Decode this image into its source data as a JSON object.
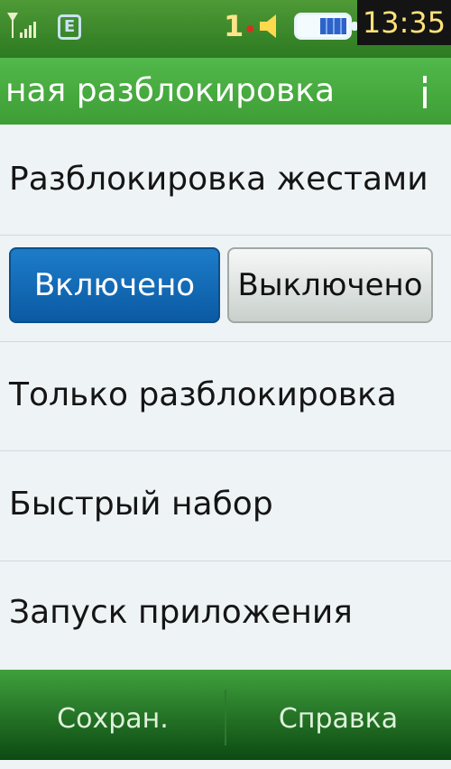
{
  "status_bar": {
    "network_type": "E",
    "sim_indicator": "1",
    "time": "13:35",
    "icons": [
      "signal-icon",
      "network-icon",
      "sim-icon",
      "volume-icon",
      "battery-icon"
    ]
  },
  "header": {
    "title": "ная разблокировка",
    "accent_color": "#3d9e35"
  },
  "settings": {
    "gesture_unlock_label": "Разблокировка жестами",
    "toggle_on_label": "Включено",
    "toggle_off_label": "Выключено",
    "toggle_selected": "on",
    "items": [
      {
        "label": "Только разблокировка"
      },
      {
        "label": "Быстрый набор"
      },
      {
        "label": "Запуск приложения"
      }
    ]
  },
  "softkeys": {
    "left_label": "Сохран.",
    "right_label": "Справка"
  }
}
